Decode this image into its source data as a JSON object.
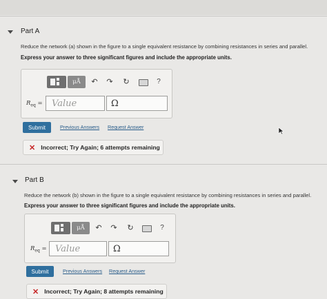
{
  "partA": {
    "title": "Part A",
    "description": "Reduce the network (a) shown in the figure to a single equivalent resistance by combining resistances in series and parallel.",
    "instruction": "Express your answer to three significant figures and include the appropriate units.",
    "toolbar": {
      "mu_label": "μÅ",
      "help_label": "?"
    },
    "req_symbol": "R",
    "req_sub": "eq",
    "req_eq": " =",
    "value_placeholder": "Value",
    "unit_value": "Ω",
    "submit_label": "Submit",
    "previous_answers_label": "Previous Answers",
    "request_answer_label": "Request Answer",
    "feedback": "Incorrect; Try Again; 6 attempts remaining"
  },
  "partB": {
    "title": "Part B",
    "description": "Reduce the network (b) shown in the figure to a single equivalent resistance by combining resistances in series and parallel.",
    "instruction": "Express your answer to three significant figures and include the appropriate units.",
    "toolbar": {
      "mu_label": "μÅ",
      "help_label": "?"
    },
    "req_symbol": "R",
    "req_sub": "eq",
    "req_eq": " =",
    "value_placeholder": "Value",
    "unit_value": "Ω",
    "submit_label": "Submit",
    "previous_answers_label": "Previous Answers",
    "request_answer_label": "Request Answer",
    "feedback": "Incorrect; Try Again; 8 attempts remaining"
  },
  "icons": {
    "undo": "↶",
    "redo": "↷",
    "reset": "↻",
    "x_mark": "✕"
  }
}
